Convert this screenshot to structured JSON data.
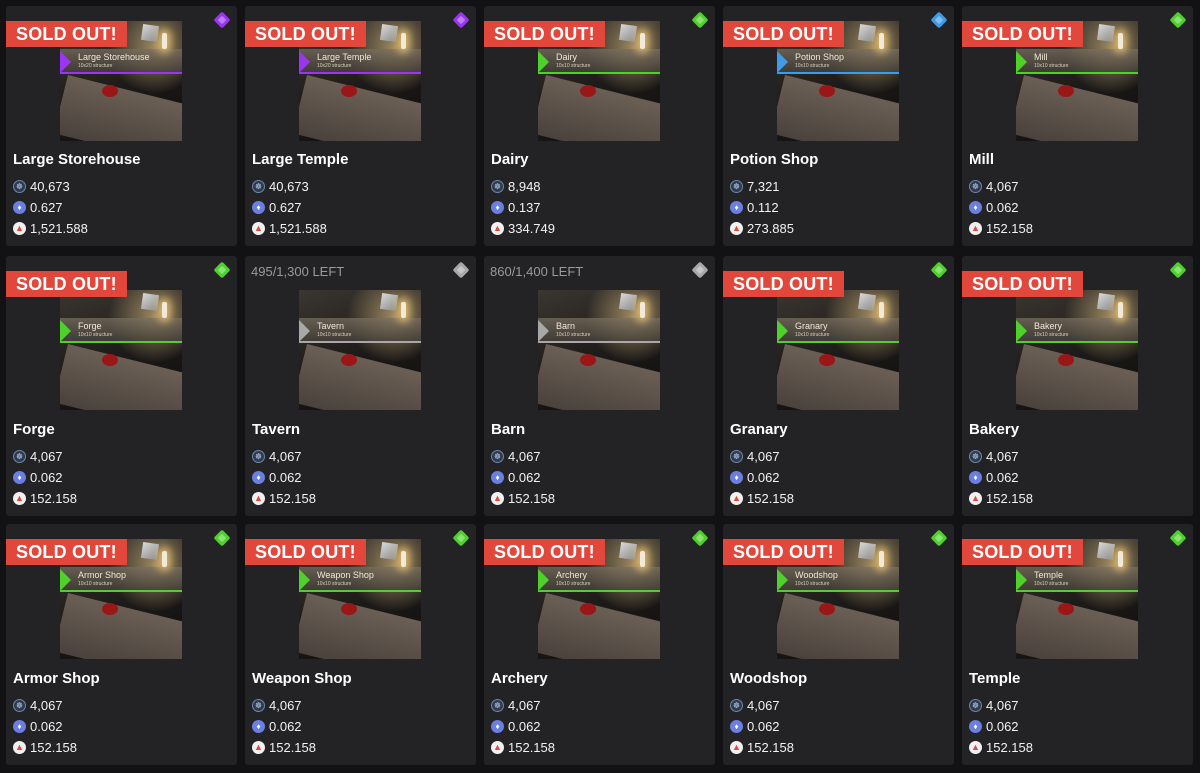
{
  "labels": {
    "sold_out": "SOLD OUT!"
  },
  "rarity_colors": {
    "epic": "#9b35f2",
    "uncommon": "#4fd12b",
    "rare": "#3d9be9",
    "common": "#a8a8a8"
  },
  "icons": {
    "price_1": "token-icon",
    "price_2": "eth-icon",
    "price_3": "triangle-token-icon",
    "rarity": "diamond-icon"
  },
  "items": [
    {
      "name": "Large Storehouse",
      "sold_out": true,
      "stock": "",
      "rarity": "epic",
      "price_1": "40,673",
      "price_2": "0.627",
      "price_3": "1,521.588",
      "thumb_title": "Large Storehouse",
      "thumb_sub": "10x20 structure"
    },
    {
      "name": "Large Temple",
      "sold_out": true,
      "stock": "",
      "rarity": "epic",
      "price_1": "40,673",
      "price_2": "0.627",
      "price_3": "1,521.588",
      "thumb_title": "Large Temple",
      "thumb_sub": "10x20 structure"
    },
    {
      "name": "Dairy",
      "sold_out": true,
      "stock": "",
      "rarity": "uncommon",
      "price_1": "8,948",
      "price_2": "0.137",
      "price_3": "334.749",
      "thumb_title": "Dairy",
      "thumb_sub": "10x10 structure"
    },
    {
      "name": "Potion Shop",
      "sold_out": true,
      "stock": "",
      "rarity": "rare",
      "price_1": "7,321",
      "price_2": "0.112",
      "price_3": "273.885",
      "thumb_title": "Potion Shop",
      "thumb_sub": "10x10 structure"
    },
    {
      "name": "Mill",
      "sold_out": true,
      "stock": "",
      "rarity": "uncommon",
      "price_1": "4,067",
      "price_2": "0.062",
      "price_3": "152.158",
      "thumb_title": "Mill",
      "thumb_sub": "10x10 structure"
    },
    {
      "name": "Forge",
      "sold_out": true,
      "stock": "",
      "rarity": "uncommon",
      "price_1": "4,067",
      "price_2": "0.062",
      "price_3": "152.158",
      "thumb_title": "Forge",
      "thumb_sub": "10x10 structure"
    },
    {
      "name": "Tavern",
      "sold_out": false,
      "stock": "495/1,300 LEFT",
      "rarity": "common",
      "price_1": "4,067",
      "price_2": "0.062",
      "price_3": "152.158",
      "thumb_title": "Tavern",
      "thumb_sub": "10x10 structure"
    },
    {
      "name": "Barn",
      "sold_out": false,
      "stock": "860/1,400 LEFT",
      "rarity": "common",
      "price_1": "4,067",
      "price_2": "0.062",
      "price_3": "152.158",
      "thumb_title": "Barn",
      "thumb_sub": "10x10 structure"
    },
    {
      "name": "Granary",
      "sold_out": true,
      "stock": "",
      "rarity": "uncommon",
      "price_1": "4,067",
      "price_2": "0.062",
      "price_3": "152.158",
      "thumb_title": "Granary",
      "thumb_sub": "10x10 structure"
    },
    {
      "name": "Bakery",
      "sold_out": true,
      "stock": "",
      "rarity": "uncommon",
      "price_1": "4,067",
      "price_2": "0.062",
      "price_3": "152.158",
      "thumb_title": "Bakery",
      "thumb_sub": "10x10 structure"
    },
    {
      "name": "Armor Shop",
      "sold_out": true,
      "stock": "",
      "rarity": "uncommon",
      "price_1": "4,067",
      "price_2": "0.062",
      "price_3": "152.158",
      "thumb_title": "Armor Shop",
      "thumb_sub": "10x10 structure"
    },
    {
      "name": "Weapon Shop",
      "sold_out": true,
      "stock": "",
      "rarity": "uncommon",
      "price_1": "4,067",
      "price_2": "0.062",
      "price_3": "152.158",
      "thumb_title": "Weapon Shop",
      "thumb_sub": "10x10 structure"
    },
    {
      "name": "Archery",
      "sold_out": true,
      "stock": "",
      "rarity": "uncommon",
      "price_1": "4,067",
      "price_2": "0.062",
      "price_3": "152.158",
      "thumb_title": "Archery",
      "thumb_sub": "10x10 structure"
    },
    {
      "name": "Woodshop",
      "sold_out": true,
      "stock": "",
      "rarity": "uncommon",
      "price_1": "4,067",
      "price_2": "0.062",
      "price_3": "152.158",
      "thumb_title": "Woodshop",
      "thumb_sub": "10x10 structure"
    },
    {
      "name": "Temple",
      "sold_out": true,
      "stock": "",
      "rarity": "uncommon",
      "price_1": "4,067",
      "price_2": "0.062",
      "price_3": "152.158",
      "thumb_title": "Temple",
      "thumb_sub": "10x10 structure"
    }
  ]
}
